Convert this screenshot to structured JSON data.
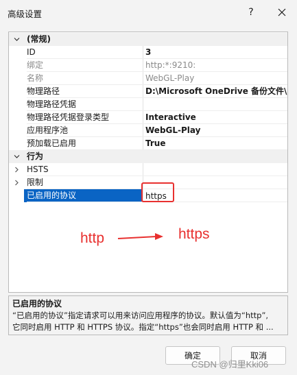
{
  "window": {
    "title": "高级设置",
    "help_label": "?"
  },
  "categories": {
    "general": "(常规)",
    "behavior": "行为"
  },
  "properties_general": [
    {
      "label": "ID",
      "value": "3"
    },
    {
      "label": "绑定",
      "value": "http:*:9210:"
    },
    {
      "label": "名称",
      "value": "WebGL-Play"
    },
    {
      "label": "物理路径",
      "value": "D:\\Microsoft OneDrive 备份文件\\O"
    },
    {
      "label": "物理路径凭据",
      "value": ""
    },
    {
      "label": "物理路径凭据登录类型",
      "value": "Interactive"
    },
    {
      "label": "应用程序池",
      "value": "WebGL-Play"
    },
    {
      "label": "预加载已启用",
      "value": "True"
    }
  ],
  "properties_behavior": [
    {
      "label": "HSTS",
      "value": ""
    },
    {
      "label": "限制",
      "value": ""
    },
    {
      "label": "已启用的协议",
      "value": "https"
    }
  ],
  "annotation": {
    "from": "http",
    "to": "https"
  },
  "description": {
    "title": "已启用的协议",
    "line1": "“已启用的协议”指定请求可以用来访问应用程序的协议。默认值为“http”,",
    "line2": "它同时启用 HTTP 和 HTTPS 协议。指定“https”也会同时启用 HTTP 和 ..."
  },
  "buttons": {
    "ok": "确定",
    "cancel": "取消"
  },
  "watermark": "CSDN @归里Kki06",
  "colors": {
    "selection": "#0a64c4",
    "annotation_red": "#e8302f"
  }
}
